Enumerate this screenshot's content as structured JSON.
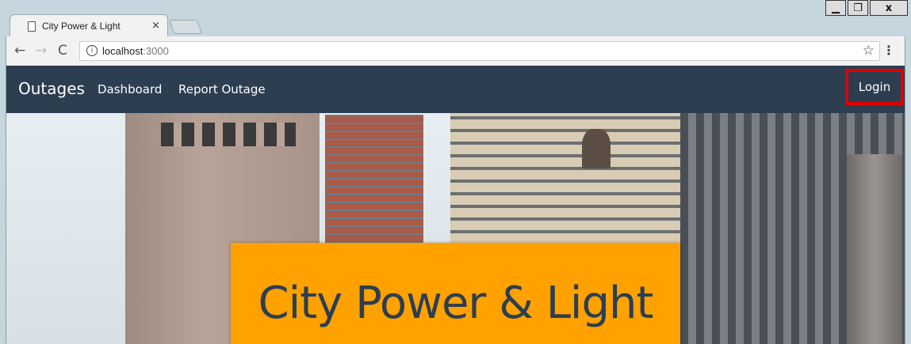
{
  "window": {
    "minimize": "▁",
    "maximize": "❐",
    "close": "x"
  },
  "tab": {
    "title": "City Power & Light",
    "close": "×"
  },
  "toolbar": {
    "back": "←",
    "forward": "→",
    "reload": "C",
    "url_host": "localhost",
    "url_port": ":3000",
    "info": "i",
    "star": "☆",
    "menu": "⋮"
  },
  "navbar": {
    "brand": "Outages",
    "links": [
      "Dashboard",
      "Report Outage"
    ],
    "login": "Login"
  },
  "hero": {
    "title": "City Power & Light"
  },
  "colors": {
    "navbar": "#2c3e50",
    "hero_box": "#ffa200",
    "highlight": "#e00000"
  }
}
